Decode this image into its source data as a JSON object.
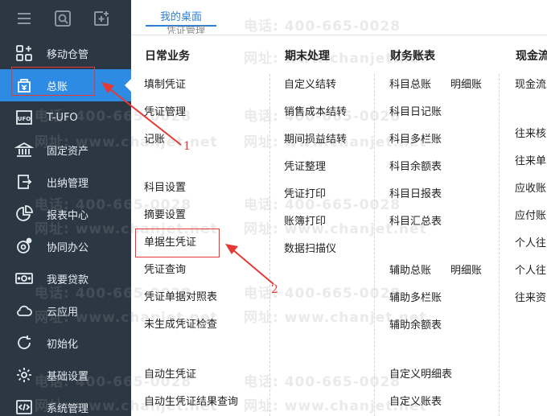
{
  "sidebar": {
    "top_icons": [
      "menu-icon",
      "search-icon",
      "new-window-icon"
    ],
    "items": [
      {
        "label": "移动仓管",
        "icon": "apps-plus-icon"
      },
      {
        "label": "总账",
        "icon": "ledger-icon",
        "active": true
      },
      {
        "label": "T-UFO",
        "icon": "ufo-icon"
      },
      {
        "label": "固定资产",
        "icon": "bank-icon"
      },
      {
        "label": "出纳管理",
        "icon": "cashier-icon"
      },
      {
        "label": "报表中心",
        "icon": "pie-chart-icon"
      },
      {
        "label": "协同办公",
        "icon": "collaboration-icon"
      },
      {
        "label": "我要贷款",
        "icon": "loan-icon"
      },
      {
        "label": "云应用",
        "icon": "cloud-icon"
      },
      {
        "label": "初始化",
        "icon": "refresh-icon"
      },
      {
        "label": "基础设置",
        "icon": "settings-icon"
      },
      {
        "label": "系统管理",
        "icon": "code-icon"
      }
    ],
    "accent": "#2e8be3",
    "background": "#2b3743"
  },
  "tabs": {
    "active": "我的桌面",
    "partial": "凭证管理"
  },
  "watermark": {
    "phone": "电话: 400-665-0028",
    "site": "网址: www.chanjet.net"
  },
  "columns": {
    "daily": {
      "title": "日常业务",
      "items": [
        "填制凭证",
        "凭证管理",
        "记账",
        "科目设置",
        "摘要设置",
        "单据生凭证",
        "凭证查询",
        "凭证单据对照表",
        "未生成凭证检查",
        "自动生凭证",
        "自动生凭证结果查询"
      ]
    },
    "period_end": {
      "title": "期末处理",
      "items": [
        "自定义结转",
        "销售成本结转",
        "期间损益结转",
        "凭证整理",
        "凭证打印",
        "账簿打印",
        "数据扫描仪"
      ]
    },
    "books": {
      "title": "财务账表",
      "items": [
        "科目总账",
        "明细账",
        "科目日记账",
        "科目多栏账",
        "科目余额表",
        "科目日报表",
        "科目汇总表",
        "辅助总账",
        "明细账",
        "辅助多栏账",
        "辅助余额表",
        "自定义明细表",
        "自定义账表"
      ]
    },
    "cash": {
      "title": "现金流",
      "items": [
        "现金流",
        "往来核",
        "往来单",
        "应收账",
        "应付账",
        "个人往",
        "个人往",
        "往来资"
      ]
    }
  },
  "annotations": {
    "label_1": "1",
    "label_2": "2",
    "color": "#e53935"
  }
}
